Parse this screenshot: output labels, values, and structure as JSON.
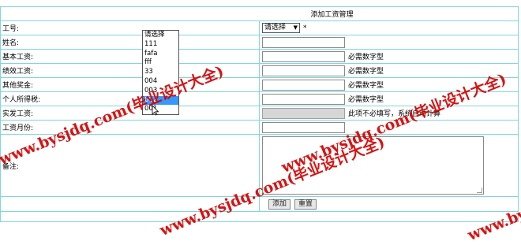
{
  "page_title": "添加工资管理",
  "fields": [
    {
      "label": "工号:",
      "type": "select",
      "value": "请选择",
      "required_mark": "*"
    },
    {
      "label": "姓名:",
      "type": "input",
      "hint": ""
    },
    {
      "label": "基本工资:",
      "type": "input",
      "hint": "必需数字型"
    },
    {
      "label": "绩效工资:",
      "type": "input",
      "hint": "必需数字型"
    },
    {
      "label": "其他奖金:",
      "type": "input",
      "hint": "必需数字型"
    },
    {
      "label": "个人所得税:",
      "type": "input",
      "hint": "必需数字型"
    },
    {
      "label": "实发工资:",
      "type": "input-disabled",
      "hint": "此项不必填写，系统自动计算"
    },
    {
      "label": "工资月份:",
      "type": "input",
      "hint": ""
    },
    {
      "label": "备注:",
      "type": "textarea"
    }
  ],
  "dropdown": {
    "options": [
      "请选择",
      "111",
      "fafa",
      "fff",
      "33",
      "004",
      "003",
      "002",
      "001"
    ],
    "highlighted": "002"
  },
  "buttons": {
    "add": "添加",
    "reset": "重置"
  },
  "watermarks": [
    "www.bysjdq.com(毕业设计大全)",
    "www.bysjdq.com(毕业设计大全)",
    "www.bysjdq.com(毕业设计大全)",
    "www.bysjdq.com(毕业设计大全)"
  ],
  "colors": {
    "border": "#7fd6dc",
    "highlight": "#3399ff",
    "watermark": "#d40000"
  }
}
